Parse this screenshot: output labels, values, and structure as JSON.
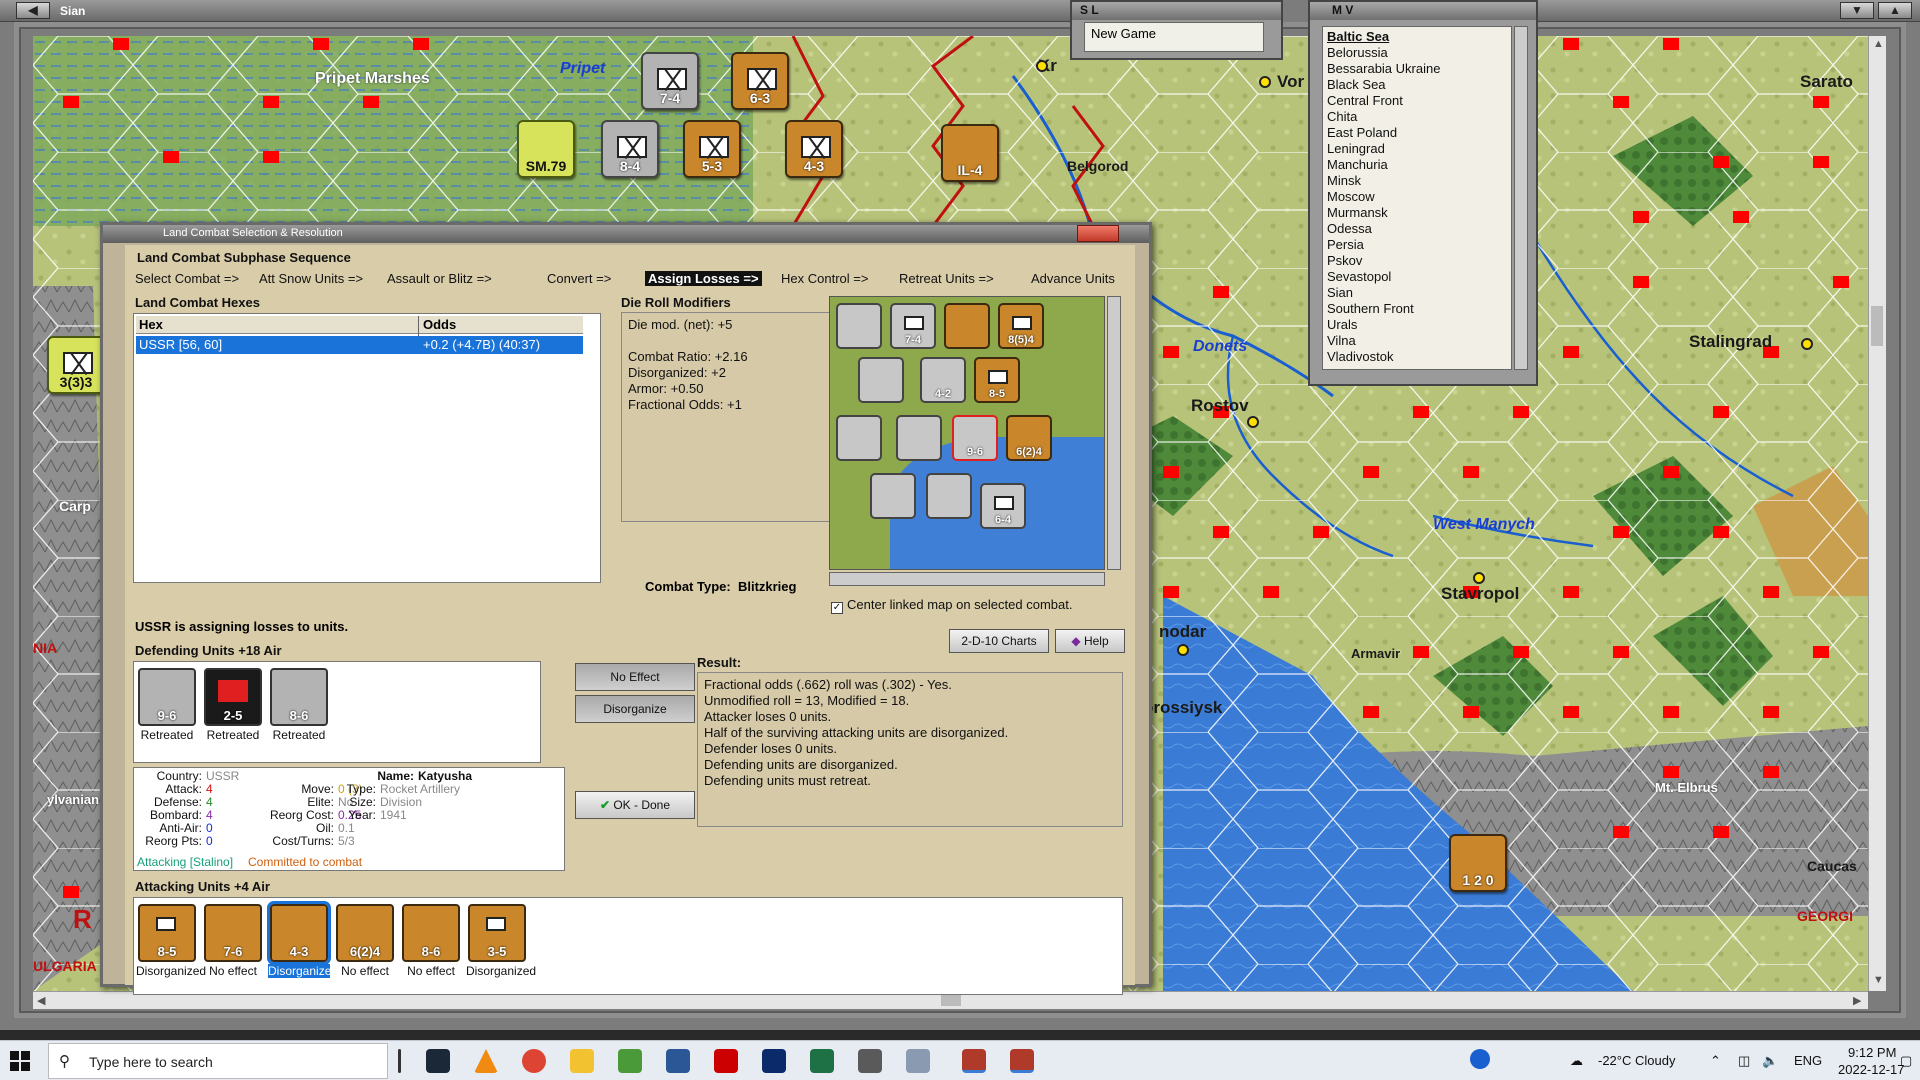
{
  "map_window": {
    "title": "Sian"
  },
  "map_labels": {
    "pripet_marshes": "Pripet Marshes",
    "pripet": "Pripet",
    "belgorod": "Belgorod",
    "vor": "Vor",
    "sarato": "Sarato",
    "stalingrad": "Stalingrad",
    "donets": "Donets",
    "rostov": "Rostov",
    "west_manych": "West Manych",
    "stavropol": "Stavropol",
    "armavir": "Armavir",
    "nodar": "nodar",
    "orossiysk": "orossiysk",
    "mt_elbrus": "Mt. Elbrus",
    "caucas": "Caucas",
    "georg": "GEORGI",
    "carp": "Carp",
    "ylvanian": "ylvanian",
    "nia": "NIA",
    "r": "R",
    "ulgaria": "ULGARIA",
    "kr": "Kr"
  },
  "sl_window": {
    "title": "S L",
    "item": "New Game"
  },
  "mv_window": {
    "title": "M V",
    "items": [
      "Baltic Sea",
      "Belorussia",
      "Bessarabia Ukraine",
      "Black Sea",
      "Central Front",
      "Chita",
      "East Poland",
      "Leningrad",
      "Manchuria",
      "Minsk",
      "Moscow",
      "Murmansk",
      "Odessa",
      "Persia",
      "Pskov",
      "Sevastopol",
      "Sian",
      "Southern Front",
      "Urals",
      "Vilna",
      "Vladivostok"
    ]
  },
  "dialog": {
    "title": "Land Combat Selection & Resolution",
    "sequence_title": "Land Combat Subphase Sequence",
    "steps": [
      "Select Combat =>",
      "Att Snow Units =>",
      "Assault or Blitz =>",
      "Convert =>",
      "Assign Losses =>",
      "Hex Control =>",
      "Retreat Units =>",
      "Advance Units"
    ],
    "hexes_label": "Land Combat Hexes",
    "hex_col": "Hex",
    "odds_col": "Odds",
    "hex_row": {
      "hex": "USSR [56, 60]",
      "odds": "+0.2 (+4.7B) (40:37)"
    },
    "drm_label": "Die Roll Modifiers",
    "drm_lines": [
      "Die mod. (net): +5",
      "",
      "Combat Ratio: +2.16",
      "Disorganized: +2",
      "Armor: +0.50",
      "Fractional Odds: +1"
    ],
    "combat_type_label": "Combat Type:",
    "combat_type": "Blitzkrieg",
    "center_linked": "Center linked map on selected combat.",
    "charts_btn": "2-D-10 Charts",
    "help_btn": "Help",
    "assign_msg": "USSR is assigning losses to units.",
    "defending_label": "Defending Units +18 Air",
    "defenders": [
      {
        "value": "9-6",
        "status": "Retreated"
      },
      {
        "value": "2-5",
        "status": "Retreated"
      },
      {
        "value": "8-6",
        "status": "Retreated"
      }
    ],
    "no_effect_btn": "No Effect",
    "disorganize_btn": "Disorganize",
    "ok_btn": "OK - Done",
    "info": {
      "country_k": "Country:",
      "country_v": "USSR",
      "attack_k": "Attack:",
      "attack_v": "4",
      "defense_k": "Defense:",
      "defense_v": "4",
      "bombard_k": "Bombard:",
      "bombard_v": "4",
      "antiair_k": "Anti-Air:",
      "antiair_v": "0",
      "reorg_k": "Reorg Pts:",
      "reorg_v": "0",
      "name_k": "Name:",
      "name_v": "Katyusha",
      "move_k": "Move:",
      "move_v": "0 (3)",
      "elite_k": "Elite:",
      "elite_v": "No",
      "reorgcost_k": "Reorg Cost:",
      "reorgcost_v": "0.25",
      "oil_k": "Oil:",
      "oil_v": "0.1",
      "cost_k": "Cost/Turns:",
      "cost_v": "5/3",
      "type_k": "Type:",
      "type_v": "Rocket Artillery",
      "size_k": "Size:",
      "size_v": "Division",
      "year_k": "Year:",
      "year_v": "1941",
      "status1": "Attacking [Stalino]",
      "status2": "Committed to combat"
    },
    "result_label": "Result:",
    "result_lines": [
      "Fractional odds (.662) roll was (.302)  - Yes.",
      "Unmodified roll = 13, Modified = 18.",
      "Attacker loses 0 units.",
      "Half of the surviving attacking units are disorganized.",
      "Defender loses 0 units.",
      "Defending units are disorganized.",
      "Defending units must retreat."
    ],
    "attacking_label": "Attacking Units +4 Air",
    "attackers": [
      {
        "value": "8-5",
        "status": "Disorganized"
      },
      {
        "value": "7-6",
        "status": "No effect"
      },
      {
        "value": "4-3",
        "status": "Disorganized"
      },
      {
        "value": "6(2)4",
        "status": "No effect"
      },
      {
        "value": "8-6",
        "status": "No effect"
      },
      {
        "value": "3-5",
        "status": "Disorganized"
      }
    ]
  },
  "map_counters": [
    {
      "value": "7-4"
    },
    {
      "value": "6-3"
    },
    {
      "value": "8-4"
    },
    {
      "value": "5-3"
    },
    {
      "value": "4-3"
    },
    {
      "value": "3(3)3"
    }
  ],
  "taskbar": {
    "search_placeholder": "Type here to search",
    "weather": "-22°C  Cloudy",
    "lang": "ENG",
    "time": "9:12 PM",
    "date": "2022-12-17"
  }
}
